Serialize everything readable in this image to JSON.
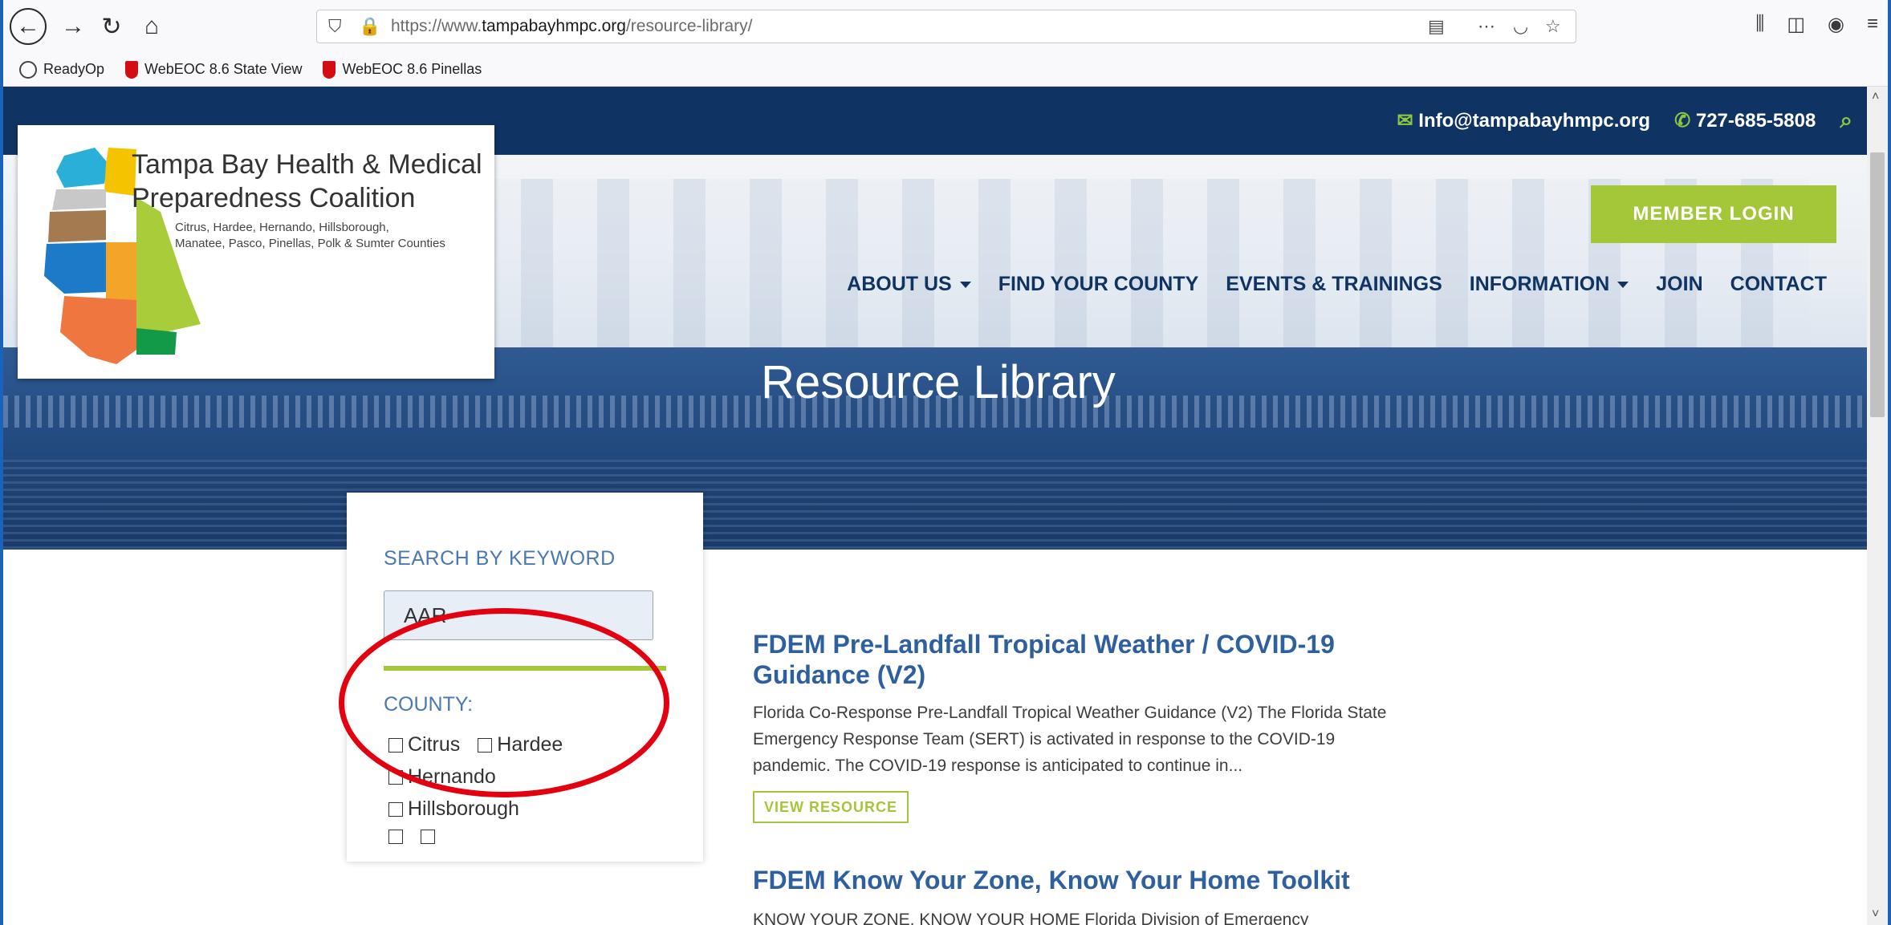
{
  "browser": {
    "url_prefix": "https://www.",
    "url_domain": "tampabayhmpc.org",
    "url_path": "/resource-library/",
    "bookmarks": [
      "ReadyOp",
      "WebEOC 8.6  State View",
      "WebEOC 8.6  Pinellas"
    ]
  },
  "topbar": {
    "email": "Info@tampabayhmpc.org",
    "phone": "727-685-5808"
  },
  "logo": {
    "title_line1": "Tampa Bay Health & Medical",
    "title_line2": "Preparedness Coalition",
    "sub_line1": "Citrus, Hardee, Hernando, Hillsborough,",
    "sub_line2": "Manatee, Pasco, Pinellas, Polk & Sumter Counties"
  },
  "header": {
    "member_login": "MEMBER LOGIN",
    "nav": [
      "ABOUT US",
      "FIND YOUR COUNTY",
      "EVENTS & TRAININGS",
      "INFORMATION",
      "JOIN",
      "CONTACT"
    ]
  },
  "hero": {
    "title": "Resource Library"
  },
  "sidebar": {
    "keyword_label": "SEARCH BY KEYWORD",
    "keyword_value": "AAR",
    "county_label": "COUNTY:",
    "counties": [
      "Citrus",
      "Hardee",
      "Hernando",
      "Hillsborough"
    ]
  },
  "resources": [
    {
      "title_line1": "FDEM Pre-Landfall Tropical Weather / COVID-19",
      "title_line2": "Guidance (V2)",
      "desc_line1": "Florida Co-Response Pre-Landfall Tropical Weather Guidance (V2) The Florida State",
      "desc_line2": "Emergency Response Team (SERT) is activated in response to the COVID-19",
      "desc_line3": "pandemic. The COVID-19 response is anticipated to continue in...",
      "button": "VIEW RESOURCE"
    },
    {
      "title_line1": "FDEM Know Your Zone, Know Your Home Toolkit",
      "desc_line1": "KNOW YOUR ZONE, KNOW YOUR HOME  Florida Division of Emergency"
    }
  ],
  "colors": {
    "navy": "#0f3463",
    "accent_green": "#a4c639",
    "link_blue": "#2e5f9e",
    "annotation_red": "#e3000f"
  }
}
